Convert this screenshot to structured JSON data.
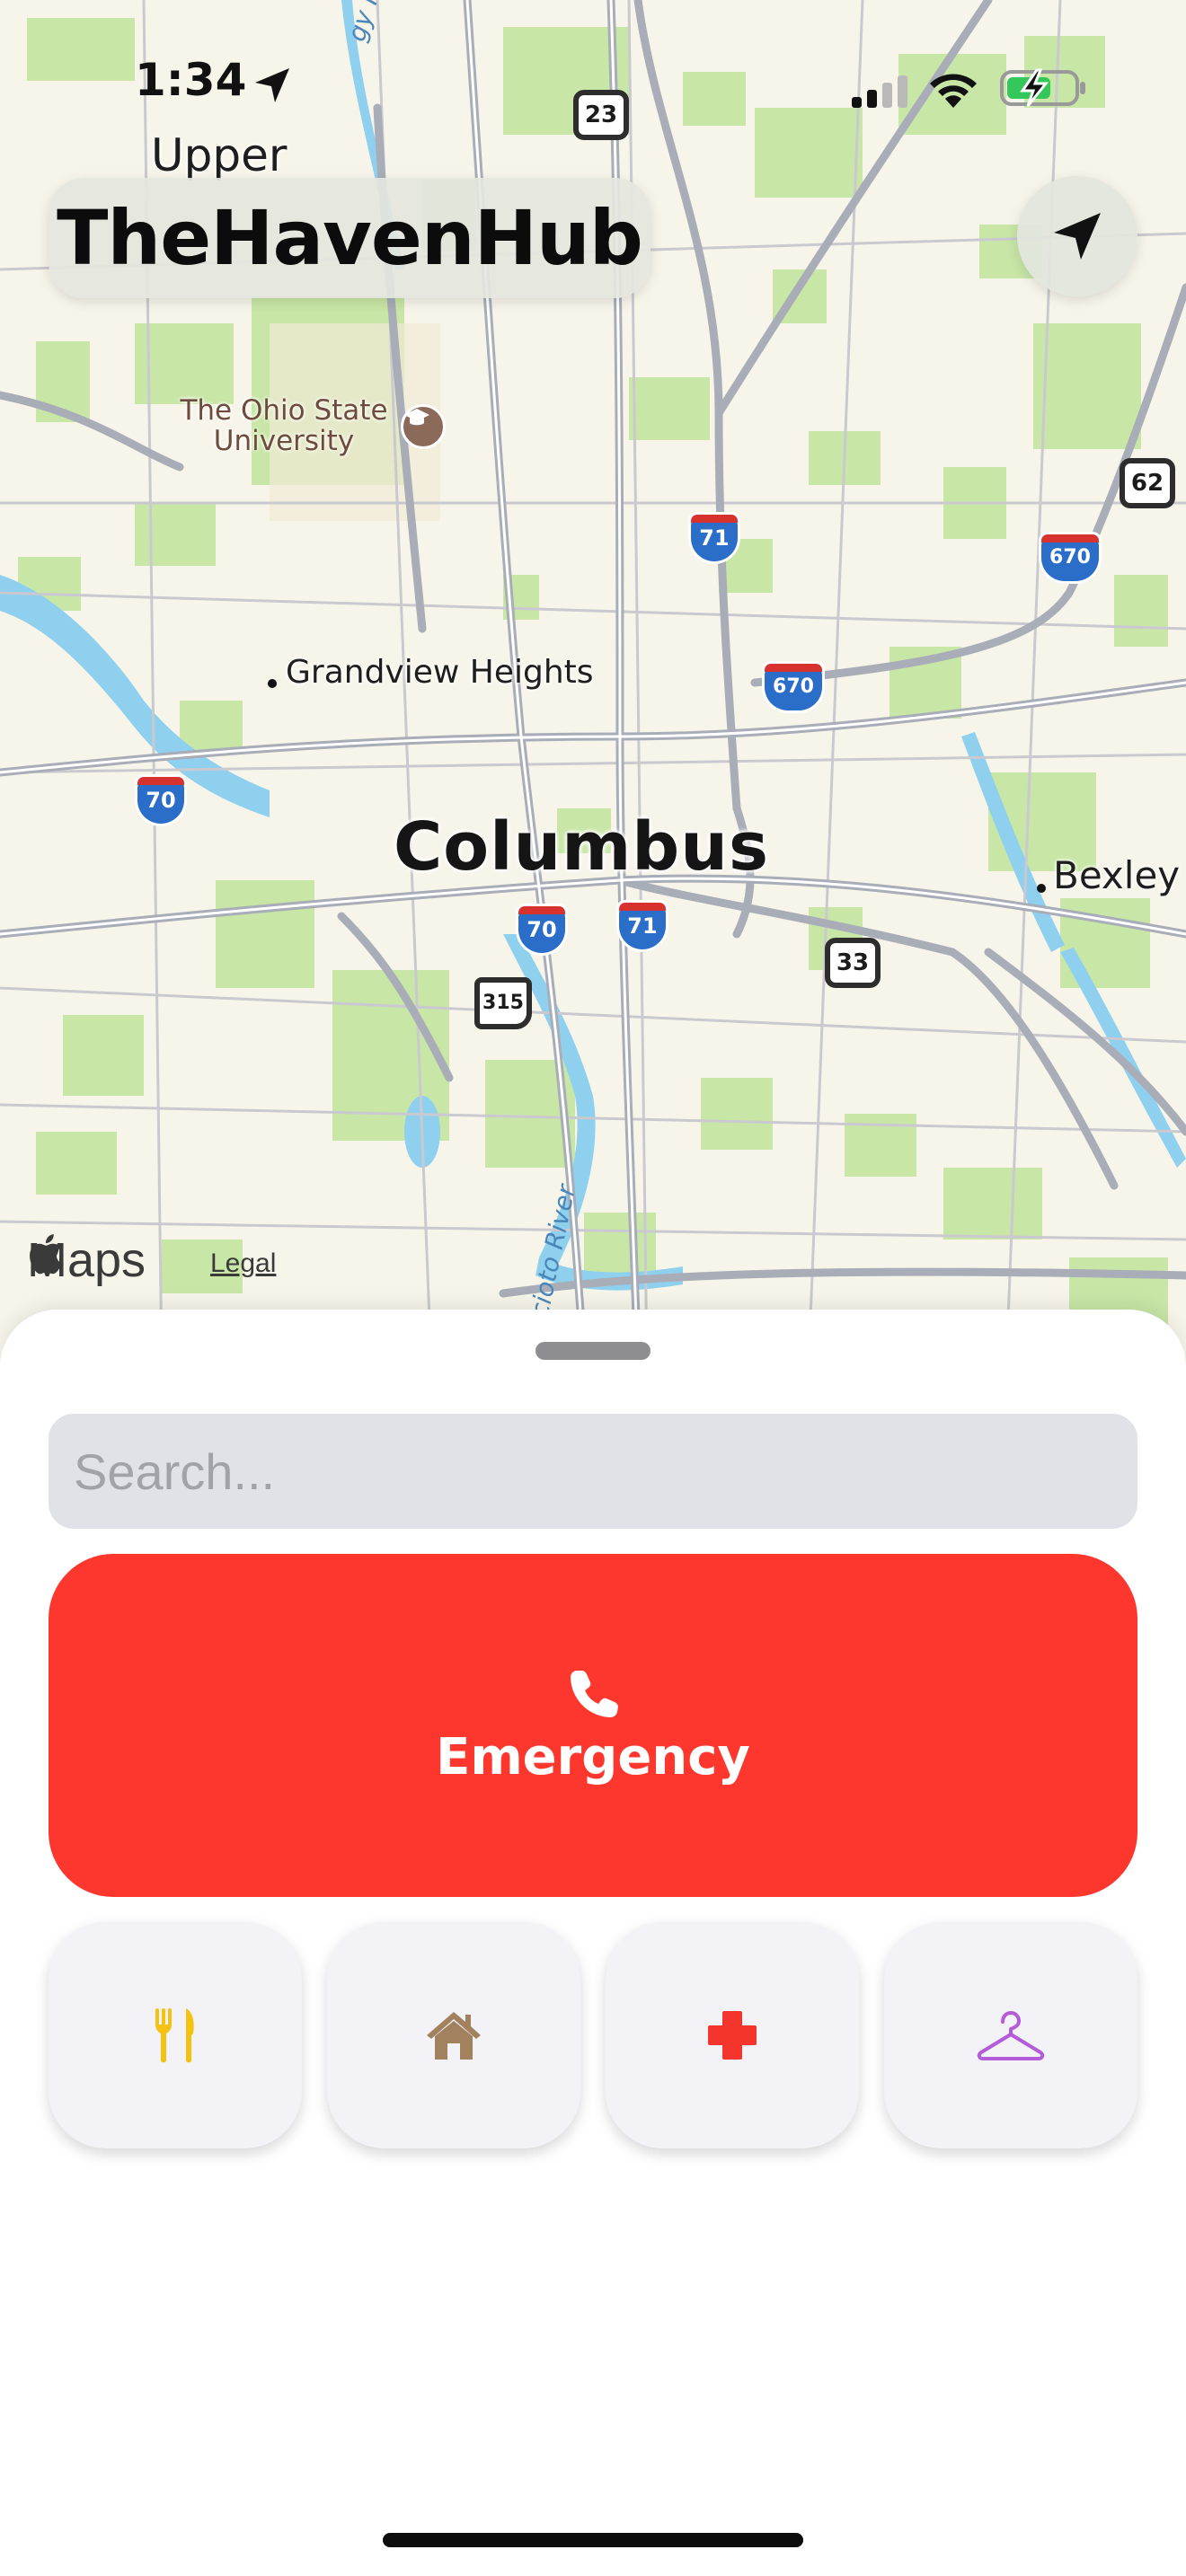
{
  "status_bar": {
    "time": "1:34",
    "location_icon": "location-arrow-icon",
    "signal_icon": "cellular-signal-icon",
    "wifi_icon": "wifi-icon",
    "battery_icon": "battery-charging-icon"
  },
  "header": {
    "title": "TheHavenHub",
    "locate_icon": "location-arrow-icon"
  },
  "map": {
    "city": "Columbus",
    "places": {
      "upper": "Upper",
      "grandview": "Grandview Heights",
      "bexley": "Bexley"
    },
    "poi": {
      "osu_line1": "The Ohio State",
      "osu_line2": "University",
      "osu_icon": "graduation-cap-icon"
    },
    "rivers": {
      "olentangy": "gy River",
      "scioto": "Scioto River"
    },
    "shields": {
      "us23": "23",
      "us62": "62",
      "us33": "33",
      "oh315": "315",
      "i71_north": "71",
      "i71_south": "71",
      "i670_east": "670",
      "i670_center": "670",
      "i70_west": "70",
      "i70_center": "70"
    },
    "attribution": {
      "maps_label": "Maps",
      "legal_label": "Legal"
    }
  },
  "sheet": {
    "search": {
      "placeholder": "Search...",
      "value": ""
    },
    "emergency": {
      "label": "Emergency",
      "icon": "phone-icon",
      "color": "#FD372E"
    },
    "categories": [
      {
        "name": "food",
        "icon": "fork-knife-icon",
        "color": "#F5C211"
      },
      {
        "name": "shelter",
        "icon": "house-icon",
        "color": "#A2815F"
      },
      {
        "name": "medical",
        "icon": "medical-cross-icon",
        "color": "#F3352C"
      },
      {
        "name": "clothing",
        "icon": "hanger-icon",
        "color": "#B35BD8"
      }
    ]
  }
}
